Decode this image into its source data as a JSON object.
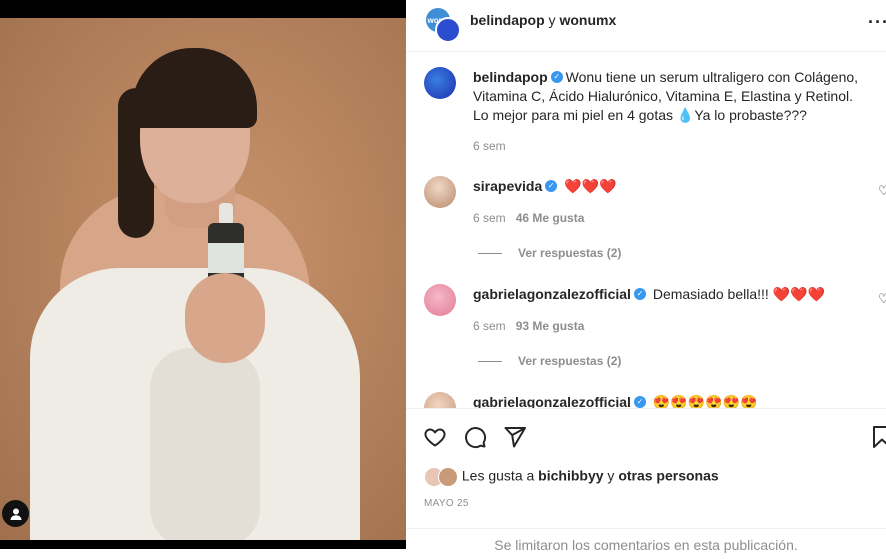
{
  "header": {
    "user1": "belindapop",
    "connector": " y ",
    "user2": "wonumx",
    "avatar_badge": "wonu"
  },
  "caption": {
    "username": "belindapop",
    "text": "Wonu tiene un serum ultraligero con Colágeno, Vitamina C, Ácido Hialurónico, Vitamina E, Elastina y Retinol. Lo mejor para mi piel en 4 gotas 💧Ya lo probaste???",
    "time": "6 sem"
  },
  "comments": [
    {
      "username": "sirapevida",
      "text": "❤️❤️❤️",
      "time": "6 sem",
      "likes": "46 Me gusta",
      "replies": "Ver respuestas (2)"
    },
    {
      "username": "gabrielagonzalezofficial",
      "text": "Demasiado bella!!! ❤️❤️❤️",
      "time": "6 sem",
      "likes": "93 Me gusta",
      "replies": "Ver respuestas (2)"
    },
    {
      "username": "gabrielagonzalezofficial",
      "text": "😍😍😍😍😍😍"
    }
  ],
  "likes": {
    "prefix": "Les gusta a ",
    "user": "bichibbyy",
    "middle": " y ",
    "others": "otras personas"
  },
  "date": "MAYO 25",
  "comments_disabled": "Se limitaron los comentarios en esta publicación.",
  "colors": {
    "verified": "#3897f0",
    "secondary_text": "#8e8e8e",
    "text": "#262626"
  }
}
